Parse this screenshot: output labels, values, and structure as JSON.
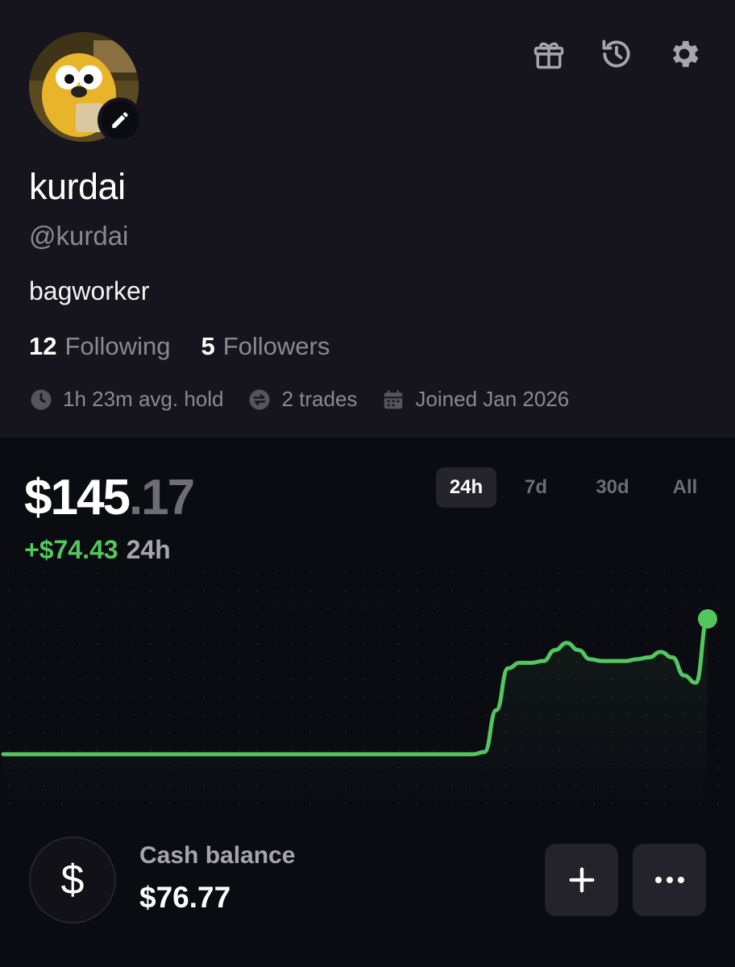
{
  "profile": {
    "display_name": "kurdai",
    "handle": "@kurdai",
    "bio": "bagworker",
    "following_count": "12",
    "following_label": "Following",
    "followers_count": "5",
    "followers_label": "Followers",
    "avg_hold": "1h 23m avg. hold",
    "trades": "2 trades",
    "joined": "Joined Jan 2026"
  },
  "top_icons": [
    "gift-icon",
    "history-icon",
    "gear-icon"
  ],
  "portfolio": {
    "value_main": "$145",
    "value_cents": ".17",
    "change_amount": "+$74.43",
    "change_period": "24h"
  },
  "range_tabs": {
    "selected": "24h",
    "tab_24h": "24h",
    "tab_7d": "7d",
    "tab_30d": "30d",
    "tab_all": "All"
  },
  "chart_data": {
    "type": "line",
    "color": "#52c75e",
    "values": [
      70.7,
      70.7,
      70.7,
      70.7,
      70.7,
      70.7,
      70.7,
      70.7,
      70.7,
      70.7,
      70.7,
      70.7,
      70.7,
      70.7,
      70.7,
      70.7,
      70.7,
      70.7,
      70.7,
      70.7,
      70.7,
      70.7,
      70.7,
      70.7,
      70.7,
      70.7,
      70.7,
      70.7,
      70.7,
      70.7,
      70.7,
      70.7,
      70.7,
      70.7,
      70.7,
      70.7,
      70.7,
      70.7,
      70.7,
      70.7,
      70.7,
      72,
      95,
      118,
      121,
      121,
      122,
      128,
      132,
      128,
      123,
      122,
      122,
      122,
      123,
      124,
      127,
      124,
      114,
      110,
      145.17
    ]
  },
  "cash": {
    "icon_glyph": "$",
    "label": "Cash balance",
    "value": "$76.77"
  },
  "colors": {
    "accent_green": "#52c75e",
    "background": "#0b0b12",
    "profile_background": "#16151d"
  }
}
